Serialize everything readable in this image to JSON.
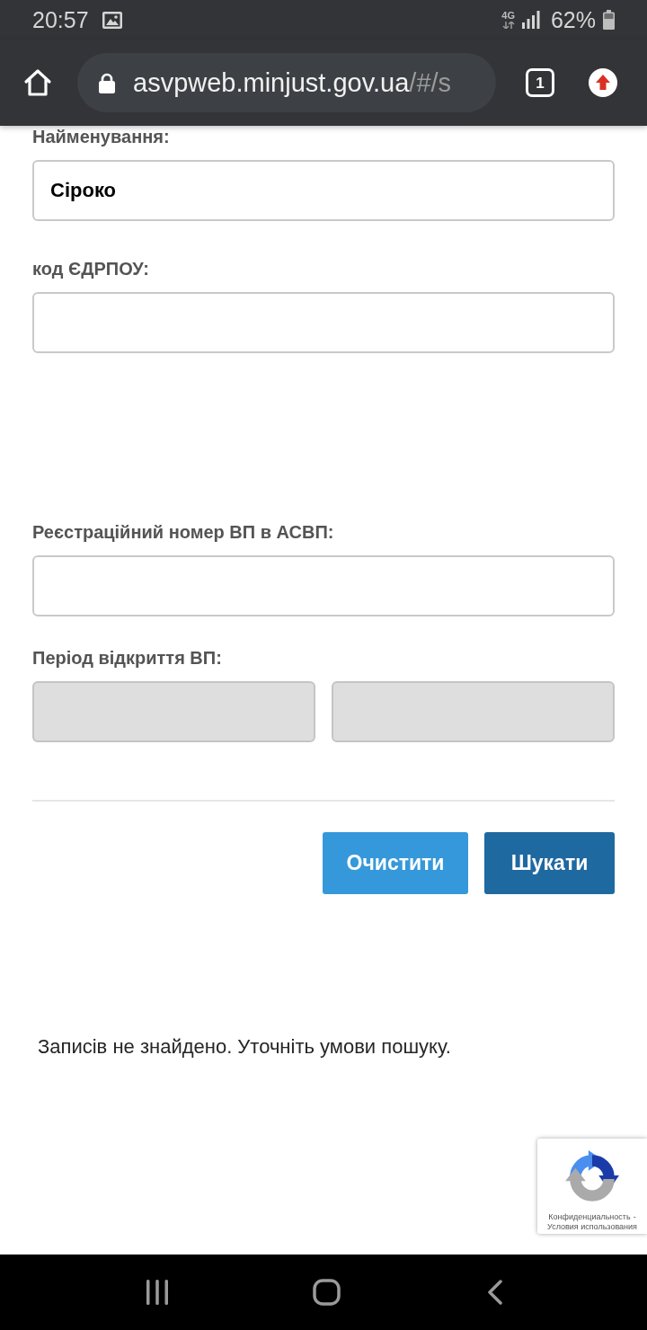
{
  "status_bar": {
    "time": "20:57",
    "network": "4G",
    "battery": "62%"
  },
  "browser": {
    "url": {
      "host": "asvpweb.minjust.gov.ua",
      "path": "/#/s"
    },
    "tab_count": "1"
  },
  "form": {
    "fields": [
      {
        "kind": "text",
        "label": "Найменування:",
        "value": "Сіроко"
      },
      {
        "kind": "text",
        "label": "код ЄДРПОУ:"
      },
      {
        "kind": "text",
        "label": "Реєстраційний номер ВП в АСВП:"
      },
      {
        "kind": "range",
        "label": "Період відкриття ВП:",
        "inputs": [
          {
            "disabled": true
          },
          {
            "disabled": true
          }
        ]
      }
    ],
    "buttons": [
      {
        "kind": "secondary",
        "label": "Очистити"
      },
      {
        "kind": "primary",
        "label": "Шукати"
      }
    ]
  },
  "message": "Записів не знайдено. Уточніть умови пошуку.",
  "captcha_badge": {
    "privacy_link": "Конфиденциальность",
    "separator": "-",
    "terms_link": "Условия использования"
  }
}
